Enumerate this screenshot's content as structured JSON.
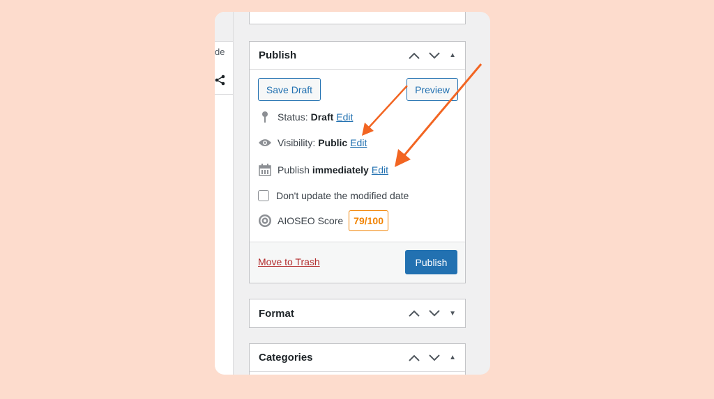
{
  "sidebar_stub": {
    "tab_text": "de"
  },
  "publish": {
    "title": "Publish",
    "save_draft": "Save Draft",
    "preview": "Preview",
    "status_label": "Status:",
    "status_value": "Draft",
    "status_edit": "Edit",
    "visibility_label": "Visibility:",
    "visibility_value": "Public",
    "visibility_edit": "Edit",
    "publish_label": "Publish",
    "publish_value": "immediately",
    "publish_edit": "Edit",
    "dont_update_label": "Don't update the modified date",
    "aioseo_label": "AIOSEO Score",
    "aioseo_score": "79/100",
    "move_to_trash": "Move to Trash",
    "publish_button": "Publish"
  },
  "format": {
    "title": "Format"
  },
  "categories": {
    "title": "Categories"
  },
  "colors": {
    "background": "#fddccd",
    "accent": "#2271b1",
    "arrow": "#f26522",
    "score": "#f18200",
    "trash": "#b32d2e"
  },
  "icons": [
    "share-icon",
    "chevron-up-icon",
    "chevron-down-icon",
    "toggle-arrow-icon",
    "pin-icon",
    "eye-icon",
    "calendar-icon",
    "aioseo-gear-icon"
  ]
}
